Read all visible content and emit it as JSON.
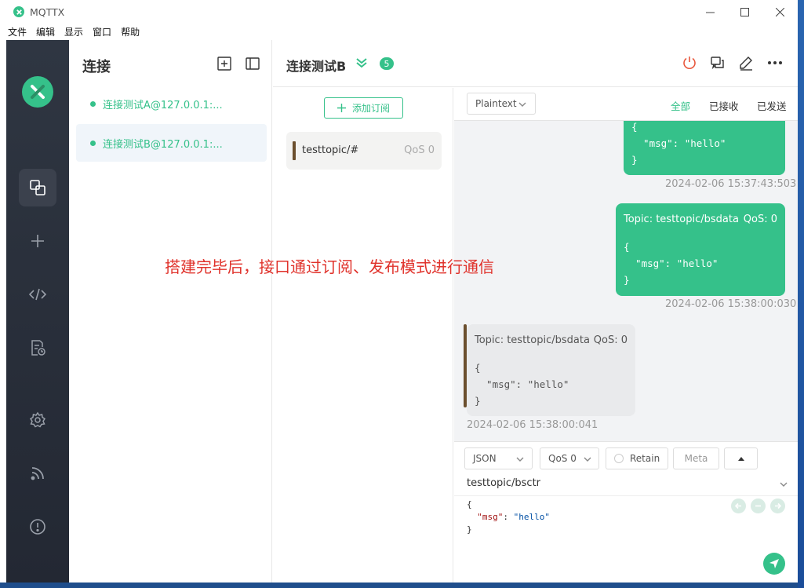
{
  "window": {
    "title": "MQTTX"
  },
  "menu": [
    "文件",
    "编辑",
    "显示",
    "窗口",
    "帮助"
  ],
  "connections_panel": {
    "title": "连接",
    "items": [
      {
        "name": "连接测试A@127.0.0.1:...",
        "active": false
      },
      {
        "name": "连接测试B@127.0.0.1:...",
        "active": true
      }
    ]
  },
  "header": {
    "connection_name": "连接测试B",
    "badge_count": "5"
  },
  "subscriptions": {
    "add_label": "添加订阅",
    "items": [
      {
        "topic": "testtopic/#",
        "qos": "QoS 0"
      }
    ]
  },
  "filters": {
    "format": "Plaintext",
    "all": "全部",
    "received": "已接收",
    "sent": "已发送"
  },
  "messages": [
    {
      "direction": "out",
      "payload": "{\n  \"msg\": \"hello\"\n}",
      "timestamp": "2024-02-06 15:37:43:503"
    },
    {
      "direction": "out",
      "topic": "Topic: testtopic/bsdata",
      "qos": "QoS: 0",
      "payload": "{\n  \"msg\": \"hello\"\n}",
      "timestamp": "2024-02-06 15:38:00:030"
    },
    {
      "direction": "in",
      "topic": "Topic: testtopic/bsdata",
      "qos": "QoS: 0",
      "payload": "{\n  \"msg\": \"hello\"\n}",
      "timestamp": "2024-02-06 15:38:00:041"
    }
  ],
  "compose": {
    "payload_format": "JSON",
    "qos": "QoS 0",
    "retain": "Retain",
    "meta": "Meta",
    "topic": "testtopic/bsctr",
    "payload_open": "{",
    "payload_key": "\"msg\"",
    "payload_sep": ": ",
    "payload_value": "\"hello\"",
    "payload_close": "}"
  },
  "annotation": "搭建完毕后，接口通过订阅、发布模式进行通信",
  "colors": {
    "accent": "#35c18a",
    "sidebar": "#2a303b",
    "annotation": "#e0322b"
  }
}
